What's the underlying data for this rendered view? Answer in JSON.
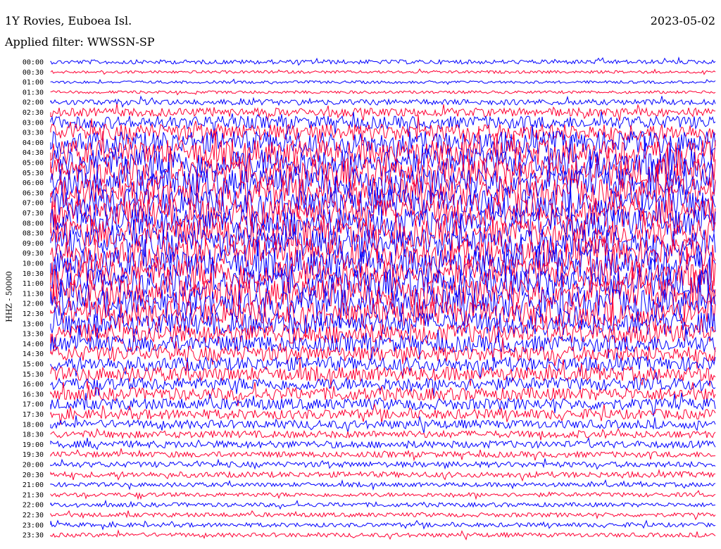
{
  "header": {
    "station": "1Y Rovies, Euboea Isl.",
    "date": "2023-05-02",
    "filter": "Applied filter: WWSSN-SP",
    "channel_label": "HHZ - 50000"
  },
  "chart_data": {
    "type": "line",
    "title": "1Y Rovies, Euboea Isl.",
    "subtitle": "Applied filter: WWSSN-SP",
    "ylabel": "HHZ - 50000",
    "xlabel": "",
    "date": "2023-05-02",
    "row_labels": [
      "00:00",
      "00:30",
      "01:00",
      "01:30",
      "02:00",
      "02:30",
      "03:00",
      "03:30",
      "04:00",
      "04:30",
      "05:00",
      "05:30",
      "06:00",
      "06:30",
      "07:00",
      "07:30",
      "08:00",
      "08:30",
      "09:00",
      "09:30",
      "10:00",
      "10:30",
      "11:00",
      "11:30",
      "12:00",
      "12:30",
      "13:00",
      "13:30",
      "14:00",
      "14:30",
      "15:00",
      "15:30",
      "16:00",
      "16:30",
      "17:00",
      "17:30",
      "18:00",
      "18:30",
      "19:00",
      "19:30",
      "20:00",
      "20:30",
      "21:00",
      "21:30",
      "22:00",
      "22:30",
      "23:00",
      "23:30"
    ],
    "row_colors": [
      "#0000ff",
      "#ff0033"
    ],
    "relative_noise_amplitude": [
      3,
      2,
      2,
      2,
      4,
      6,
      9,
      12,
      16,
      18,
      20,
      20,
      20,
      20,
      20,
      20,
      20,
      20,
      20,
      20,
      20,
      20,
      20,
      20,
      20,
      18,
      16,
      14,
      12,
      11,
      10,
      10,
      9,
      9,
      8,
      7,
      6,
      5,
      5,
      4,
      4,
      4,
      3,
      3,
      3,
      3,
      3,
      3
    ],
    "series": []
  }
}
